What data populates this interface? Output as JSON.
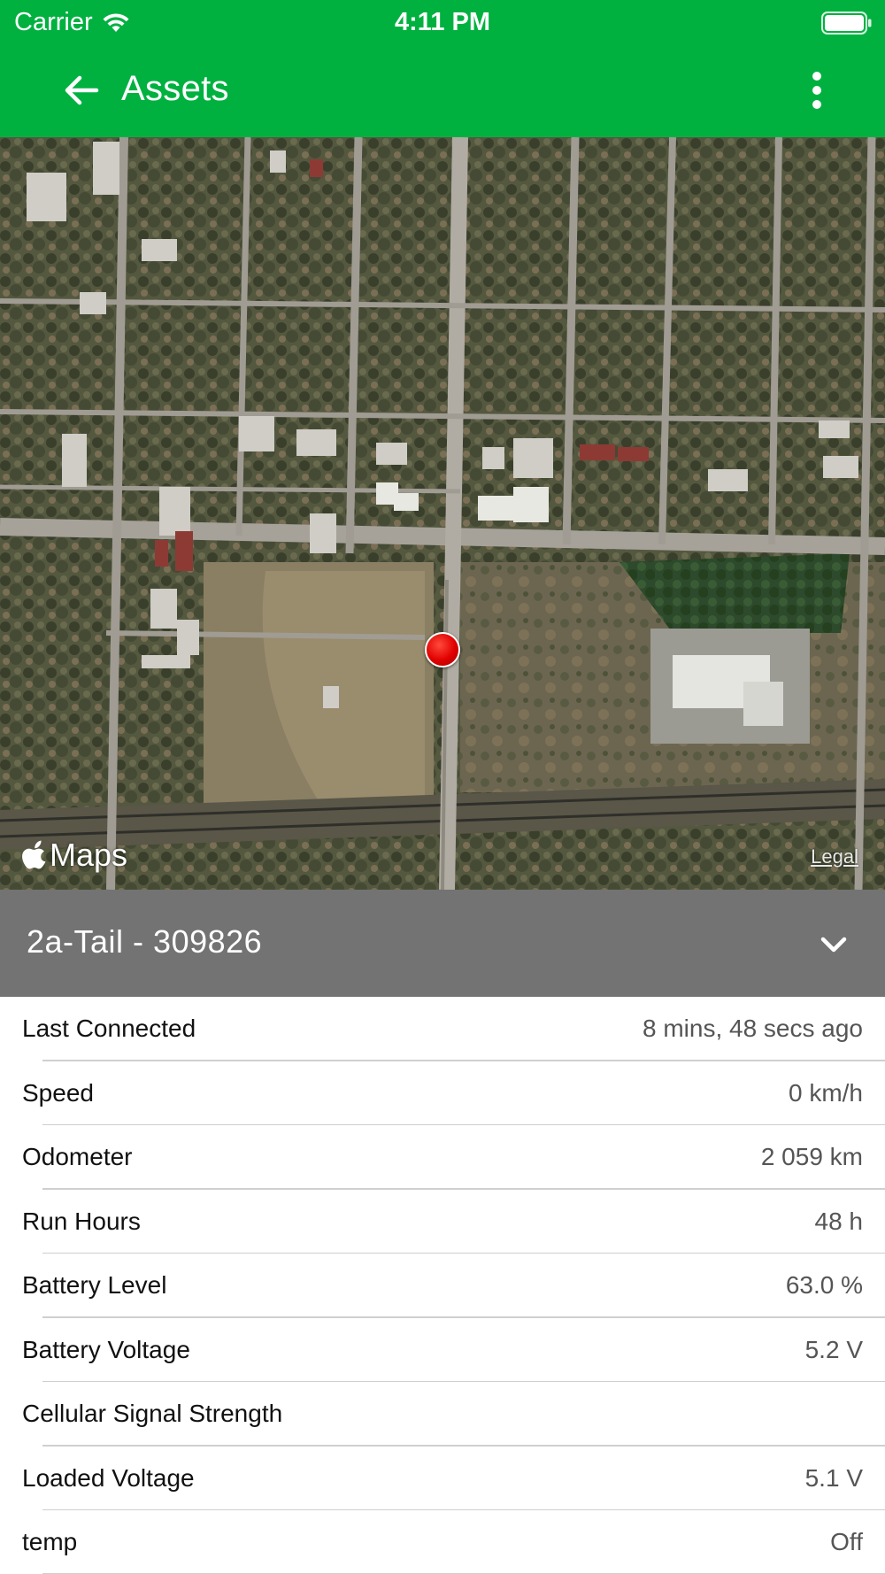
{
  "status_bar": {
    "carrier": "Carrier",
    "time": "4:11 PM"
  },
  "toolbar": {
    "title": "Assets",
    "back_icon": "arrow-left-icon",
    "menu_icon": "more-vertical-icon"
  },
  "map": {
    "logo_text": "Maps",
    "legal": "Legal",
    "marker_color": "#e00000"
  },
  "asset": {
    "name": "2a-Tail - 309826"
  },
  "details": [
    {
      "label": "Last Connected",
      "value": "8 mins, 48 secs ago"
    },
    {
      "label": "Speed",
      "value": "0 km/h"
    },
    {
      "label": "Odometer",
      "value": "2 059 km"
    },
    {
      "label": "Run Hours",
      "value": "48 h"
    },
    {
      "label": "Battery Level",
      "value": "63.0 %"
    },
    {
      "label": "Battery Voltage",
      "value": "5.2 V"
    },
    {
      "label": "Cellular Signal Strength",
      "value": ""
    },
    {
      "label": "Loaded Voltage",
      "value": "5.1 V"
    },
    {
      "label": "temp",
      "value": "Off"
    }
  ],
  "colors": {
    "header_green": "#00b140",
    "asset_bar_gray": "#737373"
  }
}
